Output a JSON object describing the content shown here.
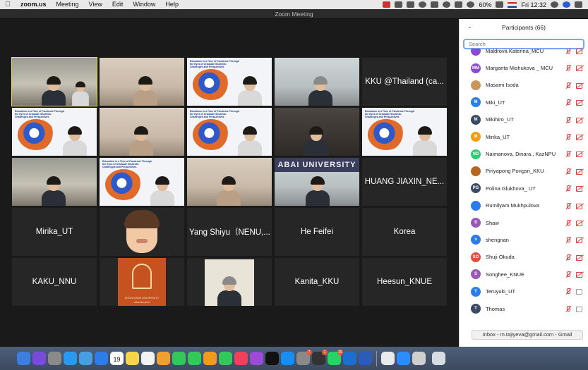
{
  "menubar": {
    "apple": "",
    "items": [
      "zoom.us",
      "Meeting",
      "View",
      "Edit",
      "Window",
      "Help"
    ],
    "battery": "60%",
    "clock": "Fri 12:32"
  },
  "window": {
    "title": "Zoom Meeting"
  },
  "video_grid": {
    "tiles": [
      {
        "kind": "video",
        "scene": "room"
      },
      {
        "kind": "video",
        "scene": "warm"
      },
      {
        "kind": "video",
        "scene": "slide"
      },
      {
        "kind": "video",
        "scene": "office"
      },
      {
        "kind": "name",
        "label": "KKU @Thailand (ca..."
      },
      {
        "kind": "video",
        "scene": "slide"
      },
      {
        "kind": "video",
        "scene": "warm"
      },
      {
        "kind": "video",
        "scene": "slide"
      },
      {
        "kind": "video",
        "scene": "dark"
      },
      {
        "kind": "video",
        "scene": "slide"
      },
      {
        "kind": "video",
        "scene": "room"
      },
      {
        "kind": "video",
        "scene": "slide"
      },
      {
        "kind": "video",
        "scene": "warm"
      },
      {
        "kind": "video",
        "scene": "abai"
      },
      {
        "kind": "name",
        "label": "HUANG JIAXIN_NE..."
      },
      {
        "kind": "name",
        "label": "Mirika_UT"
      },
      {
        "kind": "video",
        "scene": "emoji"
      },
      {
        "kind": "name",
        "label": "Yang Shiyu（NENU,..."
      },
      {
        "kind": "name",
        "label": "He Feifei"
      },
      {
        "kind": "name",
        "label": "Korea"
      },
      {
        "kind": "name",
        "label": "KAKU_NNU"
      },
      {
        "kind": "video",
        "scene": "kku"
      },
      {
        "kind": "video",
        "scene": "portrait"
      },
      {
        "kind": "name",
        "label": "Kanita_KKU"
      },
      {
        "kind": "name",
        "label": "Heesun_KNUE"
      }
    ],
    "slide_title": "Education in a Time of Pandemic Through the Eyes of Graduate Students: Challenges and Perspectives",
    "kku_logo_caption": "KHON KAEN UNIVERSITY",
    "kku_logo_url": "www.kku.ac.th",
    "abai_banner": "ABAI UNIVERSITY"
  },
  "participants": {
    "title": "Participants (66)",
    "search_placeholder": "Search",
    "list": [
      {
        "initials": "",
        "name": "Maldrova Katerina_MCU",
        "color": "#8a4bd3",
        "video": "off"
      },
      {
        "initials": "MM",
        "name": "Margarita Mishukova _ MCU",
        "color": "#8a4bd3",
        "video": "off"
      },
      {
        "initials": "",
        "name": "Masami Isoda",
        "color": "#c9975a",
        "video": "off"
      },
      {
        "initials": "M",
        "name": "Miki_UT",
        "color": "#2b7de9",
        "video": "off"
      },
      {
        "initials": "M",
        "name": "Mikihiro_UT",
        "color": "#3b4a66",
        "video": "off"
      },
      {
        "initials": "M",
        "name": "Mirika_UT",
        "color": "#f39c12",
        "video": "off"
      },
      {
        "initials": "ND",
        "name": "Naimanova, Dinara., KazNPU",
        "color": "#2ecc71",
        "video": "off"
      },
      {
        "initials": "",
        "name": "Piriyapong Pongsri_KKU",
        "color": "#b5651d",
        "video": "off"
      },
      {
        "initials": "PG",
        "name": "Polina Glukhova_ UT",
        "color": "#3b4a66",
        "video": "off"
      },
      {
        "initials": "",
        "name": "Rumilyam Mukhpulova",
        "color": "#2b7de9",
        "video": "off"
      },
      {
        "initials": "S",
        "name": "Shaw",
        "color": "#9b59b6",
        "video": "off"
      },
      {
        "initials": "s",
        "name": "shengnan",
        "color": "#2b7de9",
        "video": "off"
      },
      {
        "initials": "SO",
        "name": "Shuji Okuda",
        "color": "#e74c3c",
        "video": "off"
      },
      {
        "initials": "S",
        "name": "Songhee_KNUE",
        "color": "#9b59b6",
        "video": "off"
      },
      {
        "initials": "T",
        "name": "Teruyuki_UT",
        "color": "#2b7de9",
        "video": "off-muted"
      },
      {
        "initials": "T",
        "name": "Thomas",
        "color": "#3b4a66",
        "video": "off-muted"
      }
    ]
  },
  "notification": {
    "text": "Inbox - m.tajiyeva@gmail.com - Gmail"
  },
  "dock": {
    "calendar_day": "19",
    "badges": {
      "system_prefs": "7",
      "activity": "1",
      "whatsapp": "29"
    },
    "apps": [
      "finder-icon",
      "siri-icon",
      "launchpad-icon",
      "safari-icon",
      "preview-icon",
      "mail-icon",
      "calendar-icon",
      "notes-icon",
      "reminders-icon",
      "photos-icon",
      "messages-icon",
      "facetime-icon",
      "pages-icon",
      "numbers-icon",
      "music-icon",
      "podcasts-icon",
      "tv-icon",
      "appstore-icon",
      "system-prefs-icon",
      "activity-icon",
      "whatsapp-icon",
      "trello-icon",
      "word-icon",
      "chrome-icon",
      "zoom-icon",
      "spotlight-icon"
    ]
  }
}
